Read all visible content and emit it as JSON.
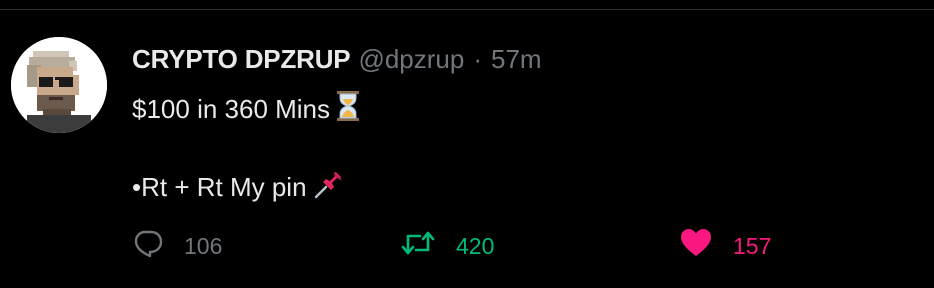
{
  "tweet": {
    "display_name": "CRYPTO DPZRUP",
    "handle": "@dpzrup",
    "separator": "·",
    "time": "57m",
    "line1_text": "$100 in 360 Mins",
    "line1_emoji": "hourglass-icon",
    "line2_text": "•Rt + Rt My pin",
    "line2_emoji": "pushpin-icon"
  },
  "actions": {
    "reply_count": "106",
    "retweet_count": "420",
    "like_count": "157"
  },
  "colors": {
    "background": "#000000",
    "text": "#e7e9ea",
    "muted": "#71767b",
    "retweet_active": "#00ba7c",
    "like_active": "#f91880",
    "divider": "#2f3336"
  }
}
